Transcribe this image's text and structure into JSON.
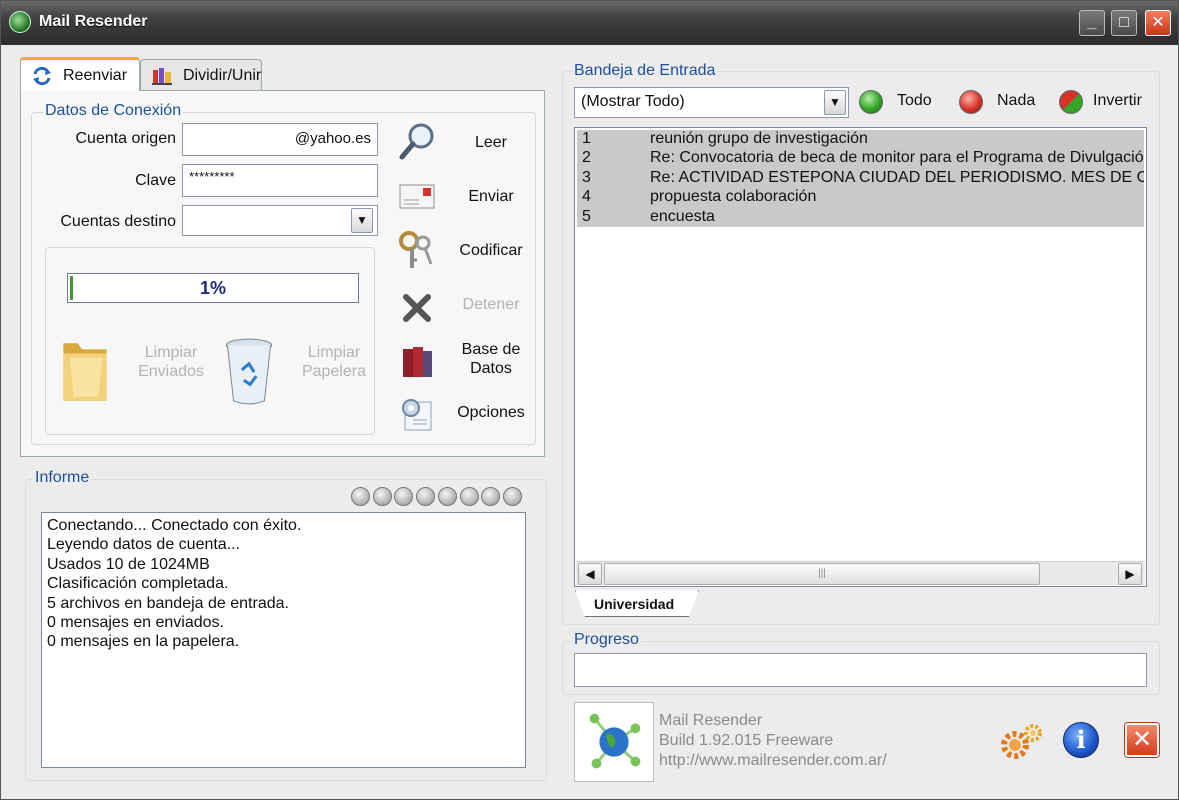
{
  "window": {
    "title": "Mail Resender"
  },
  "tabs": [
    {
      "label": "Reenviar",
      "active": true
    },
    {
      "label": "Dividir/Unir",
      "active": false
    }
  ],
  "conexion": {
    "legend": "Datos de Conexión",
    "cuenta_origen_label": "Cuenta origen",
    "cuenta_origen_value": "@yahoo.es",
    "clave_label": "Clave",
    "clave_value": "*********",
    "cuentas_destino_label": "Cuentas destino",
    "cuentas_destino_value": ""
  },
  "progress": {
    "value_text": "1%",
    "fraction": 0.01
  },
  "cleanup": {
    "limpiar_enviados": [
      "Limpiar",
      "Enviados"
    ],
    "limpiar_papelera": [
      "Limpiar",
      "Papelera"
    ]
  },
  "side_buttons": {
    "leer": "Leer",
    "enviar": "Enviar",
    "codificar": "Codificar",
    "detener": "Detener",
    "base_datos": [
      "Base de",
      "Datos"
    ],
    "opciones": "Opciones"
  },
  "informe": {
    "legend": "Informe",
    "lines": [
      "Conectando... Conectado con éxito.",
      "Leyendo datos de cuenta...",
      "Usados 10 de 1024MB",
      "Clasificación completada.",
      "5 archivos en bandeja de entrada.",
      "0 mensajes en enviados.",
      "0 mensajes en la papelera."
    ]
  },
  "bandeja": {
    "legend": "Bandeja de Entrada",
    "filter_value": "(Mostrar Todo)",
    "todo_label": "Todo",
    "nada_label": "Nada",
    "invertir_label": "Invertir",
    "messages": [
      {
        "num": "1",
        "subject": "reunión grupo de investigación"
      },
      {
        "num": "2",
        "subject": "Re: Convocatoria de beca de monitor para el Programa de Divulgación"
      },
      {
        "num": "3",
        "subject": "Re: ACTIVIDAD ESTEPONA CIUDAD DEL PERIODISMO. MES DE O"
      },
      {
        "num": "4",
        "subject": "propuesta colaboración"
      },
      {
        "num": "5",
        "subject": "encuesta"
      }
    ],
    "folder_tab": "Universidad",
    "scroll_grip": "|||"
  },
  "progreso": {
    "legend": "Progreso"
  },
  "about": {
    "name": "Mail Resender",
    "build": "Build 1.92.015 Freeware",
    "url": "http://www.mailresender.com.ar/"
  },
  "colors": {
    "accent_blue": "#1d4f9a",
    "tab_highlight": "#f3a93b",
    "close_red": "#d9431f",
    "selected_row": "#c9c9c9"
  }
}
